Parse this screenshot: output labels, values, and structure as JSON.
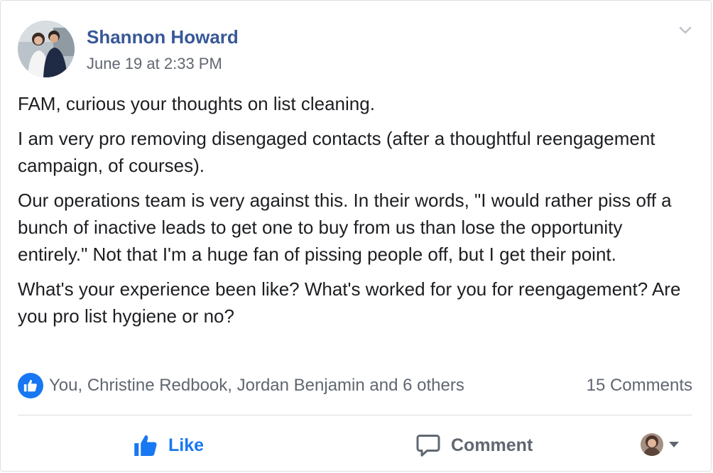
{
  "post": {
    "author": "Shannon Howard",
    "timestamp": "June 19 at 2:33 PM",
    "paragraphs": [
      "FAM, curious your thoughts on list cleaning.",
      "I am very pro removing disengaged contacts (after a thoughtful reengagement campaign, of courses).",
      "Our operations team is very against this. In their words, \"I would rather piss off a bunch of inactive leads to get one to buy from us than lose the opportunity entirely.\" Not that I'm a huge fan of pissing people off, but I get their point.",
      "What's your experience been like? What's worked for you for reengagement? Are you pro list hygiene or no?"
    ]
  },
  "footer": {
    "reactions_text": "You, Christine Redbook, Jordan Benjamin and 6 others",
    "comments_count": "15 Comments"
  },
  "actions": {
    "like_label": "Like",
    "comment_label": "Comment"
  },
  "icons": {
    "options": "chevron-down-icon",
    "reaction": "thumbs-up-icon",
    "like": "thumbs-up-icon",
    "comment": "speech-bubble-icon",
    "share_as_caret": "caret-down-icon"
  },
  "colors": {
    "author_link": "#385898",
    "like_blue": "#1877f2",
    "secondary_text": "#606770"
  }
}
